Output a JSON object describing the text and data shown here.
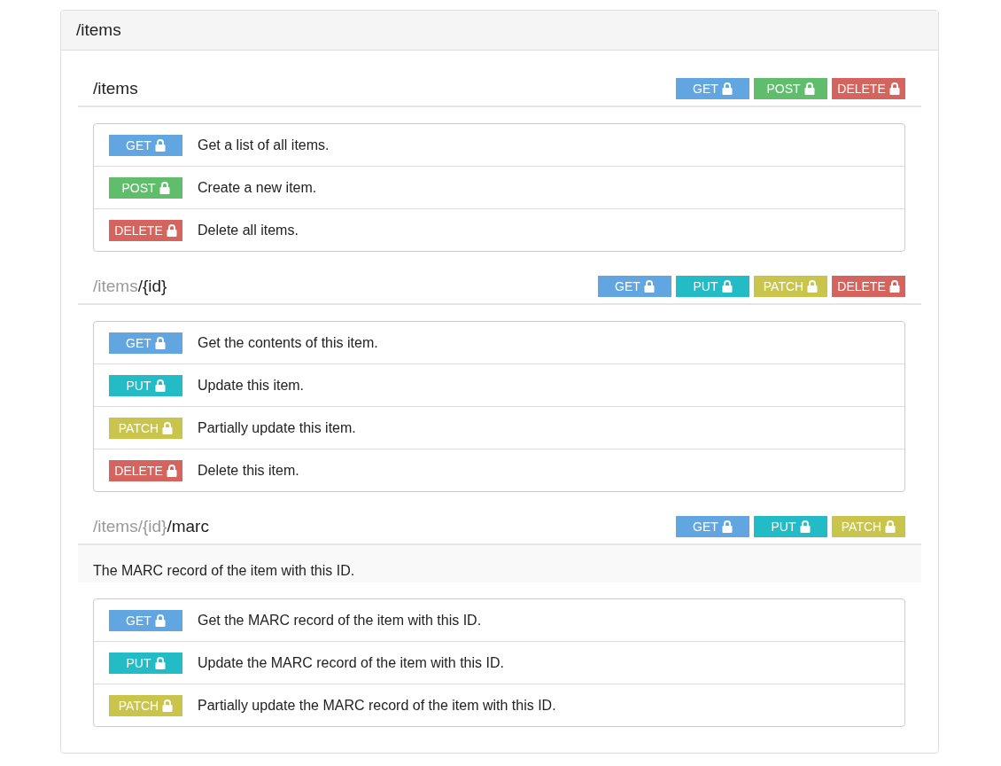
{
  "panel": {
    "title": "/items"
  },
  "resources": [
    {
      "path_tail": "/items",
      "methods": [
        {
          "kind": "get",
          "label": "GET"
        },
        {
          "kind": "post",
          "label": "POST"
        },
        {
          "kind": "delete",
          "label": "DELETE"
        }
      ],
      "operations": [
        {
          "method": {
            "kind": "get",
            "label": "GET"
          },
          "summary": "Get a list of all items."
        },
        {
          "method": {
            "kind": "post",
            "label": "POST"
          },
          "summary": "Create a new item."
        },
        {
          "method": {
            "kind": "delete",
            "label": "DELETE"
          },
          "summary": "Delete all items."
        }
      ]
    },
    {
      "path_prefix": "/items",
      "path_tail": "/{id}",
      "methods": [
        {
          "kind": "get",
          "label": "GET"
        },
        {
          "kind": "put",
          "label": "PUT"
        },
        {
          "kind": "patch",
          "label": "PATCH"
        },
        {
          "kind": "delete",
          "label": "DELETE"
        }
      ],
      "operations": [
        {
          "method": {
            "kind": "get",
            "label": "GET"
          },
          "summary": "Get the contents of this item."
        },
        {
          "method": {
            "kind": "put",
            "label": "PUT"
          },
          "summary": "Update this item."
        },
        {
          "method": {
            "kind": "patch",
            "label": "PATCH"
          },
          "summary": "Partially update this item."
        },
        {
          "method": {
            "kind": "delete",
            "label": "DELETE"
          },
          "summary": "Delete this item."
        }
      ]
    },
    {
      "path_prefix": "/items/{id}",
      "path_tail": "/marc",
      "methods": [
        {
          "kind": "get",
          "label": "GET"
        },
        {
          "kind": "put",
          "label": "PUT"
        },
        {
          "kind": "patch",
          "label": "PATCH"
        }
      ],
      "description": "The MARC record of the item with this ID.",
      "operations": [
        {
          "method": {
            "kind": "get",
            "label": "GET"
          },
          "summary": "Get the MARC record of the item with this ID."
        },
        {
          "method": {
            "kind": "put",
            "label": "PUT"
          },
          "summary": "Update the MARC record of the item with this ID."
        },
        {
          "method": {
            "kind": "patch",
            "label": "PATCH"
          },
          "summary": "Partially update the MARC record of the item with this ID."
        }
      ]
    }
  ]
}
